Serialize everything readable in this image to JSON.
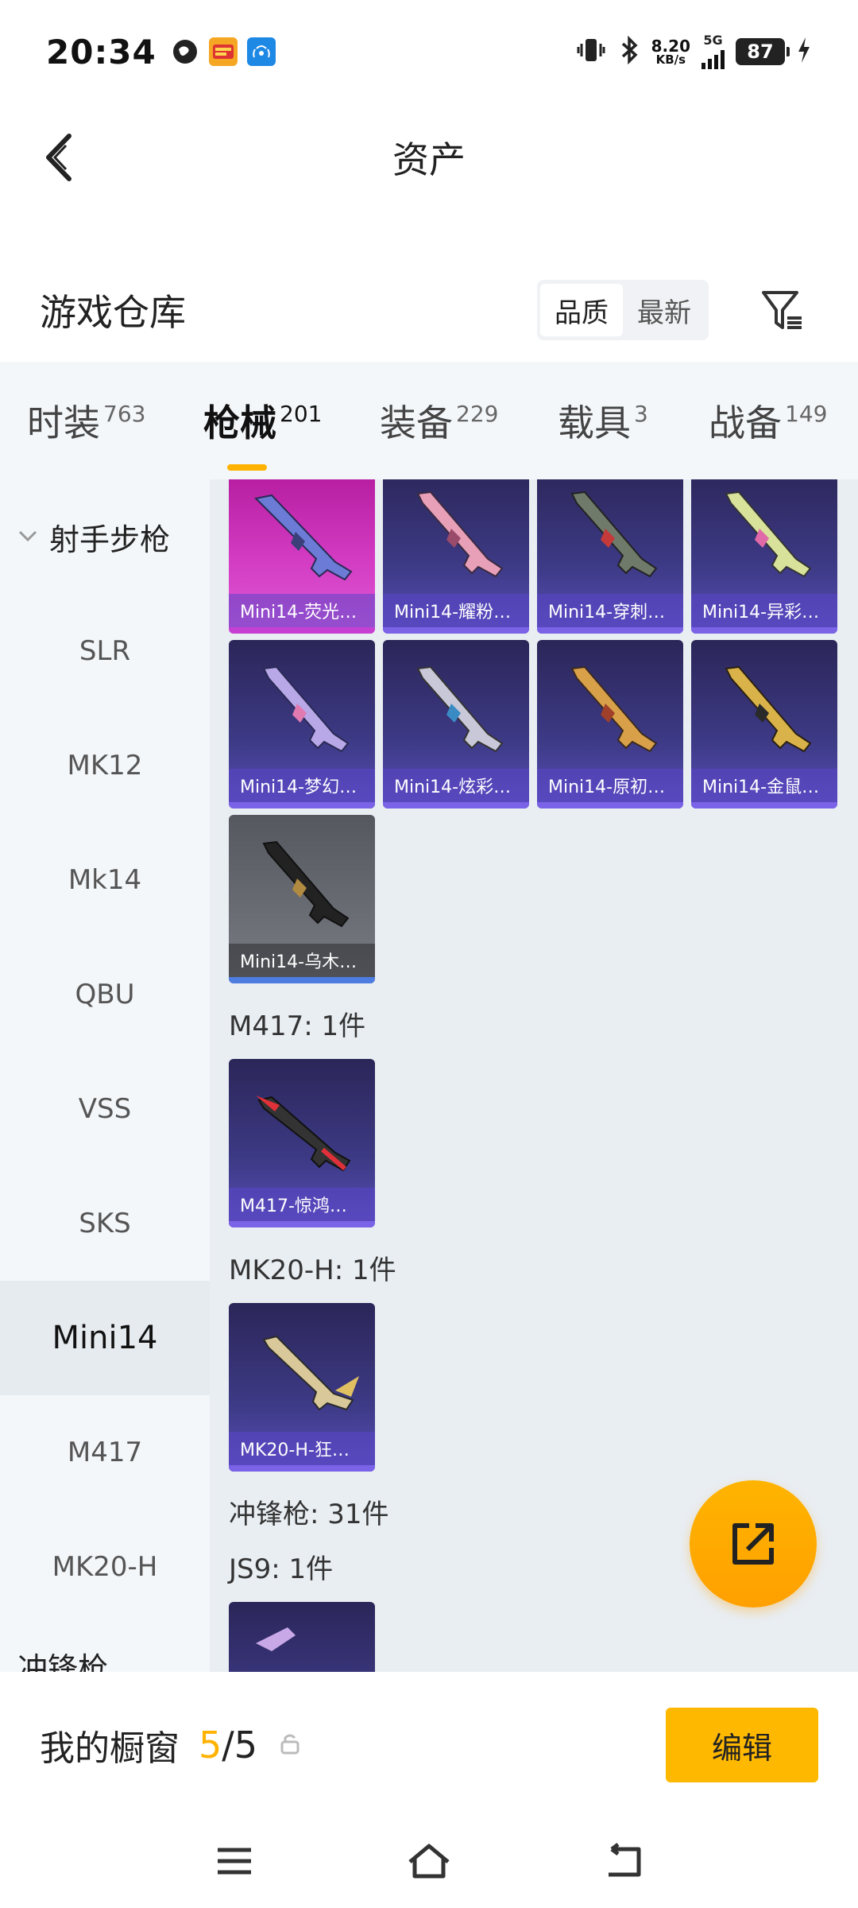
{
  "status_bar": {
    "time": "20:34",
    "net_speed_value": "8.20",
    "net_speed_unit": "KB/s",
    "network": "5G",
    "battery": "87"
  },
  "header": {
    "title": "资产"
  },
  "warehouse": {
    "title": "游戏仓库",
    "sort_quality": "品质",
    "sort_latest": "最新"
  },
  "tabs": [
    {
      "label": "时装",
      "count": "763"
    },
    {
      "label": "枪械",
      "count": "201"
    },
    {
      "label": "装备",
      "count": "229"
    },
    {
      "label": "载具",
      "count": "3"
    },
    {
      "label": "战备",
      "count": "149"
    }
  ],
  "sidebar": {
    "group": "射手步枪",
    "items": [
      "SLR",
      "MK12",
      "Mk14",
      "QBU",
      "VSS",
      "SKS",
      "Mini14",
      "M417",
      "MK20-H"
    ],
    "active": "Mini14",
    "next_group_partial": "冲锋枪"
  },
  "content": {
    "mini14_items": [
      "Mini14-荧光…",
      "Mini14-耀粉…",
      "Mini14-穿刺…",
      "Mini14-异彩…",
      "Mini14-梦幻…",
      "Mini14-炫彩…",
      "Mini14-原初…",
      "Mini14-金鼠…",
      "Mini14-乌木…"
    ],
    "m417_label": "M417: 1件",
    "m417_items": [
      "M417-惊鸿…"
    ],
    "mk20_label": "MK20-H: 1件",
    "mk20_items": [
      "MK20-H-狂…"
    ],
    "smg_label": "冲锋枪: 31件",
    "js9_label": "JS9: 1件"
  },
  "showcase": {
    "title": "我的橱窗",
    "count_current": "5",
    "count_sep_total": "/5",
    "edit_label": "编辑"
  },
  "colors": {
    "accent": "#ffb300",
    "card_purple": "#3d3a86",
    "card_pink": "#d23bc2",
    "card_gray": "#6a6d74"
  }
}
